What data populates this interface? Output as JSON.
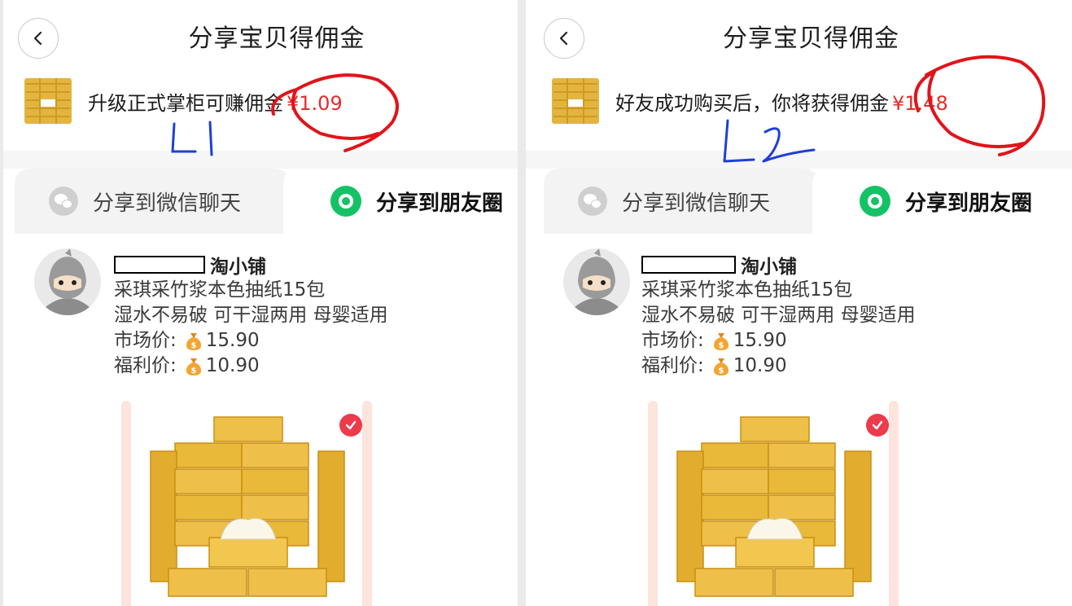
{
  "left_panel": {
    "title": "分享宝贝得佣金",
    "promo_text": "升级正式掌柜可赚佣金",
    "promo_amount": "¥1.09",
    "annotation_label": "L1",
    "tabs": [
      {
        "label": "分享到微信聊天",
        "icon": "wechat-icon",
        "active": false
      },
      {
        "label": "分享到朋友圈",
        "icon": "moments-icon",
        "active": true
      }
    ],
    "shop_name": "淘小铺",
    "product_title": "采琪采竹浆本色抽纸15包",
    "product_subtitle": "湿水不易破 可干湿两用 母婴适用",
    "market_price_label": "市场价:",
    "market_price": "15.90",
    "welfare_price_label": "福利价:",
    "welfare_price": "10.90"
  },
  "right_panel": {
    "title": "分享宝贝得佣金",
    "promo_text": "好友成功购买后，你将获得佣金",
    "promo_amount": "¥1.48",
    "annotation_label": "L2",
    "tabs": [
      {
        "label": "分享到微信聊天",
        "icon": "wechat-icon",
        "active": false
      },
      {
        "label": "分享到朋友圈",
        "icon": "moments-icon",
        "active": true
      }
    ],
    "shop_name": "淘小铺",
    "product_title": "采琪采竹浆本色抽纸15包",
    "product_subtitle": "湿水不易破 可干湿两用 母婴适用",
    "market_price_label": "市场价:",
    "market_price": "15.90",
    "welfare_price_label": "福利价:",
    "welfare_price": "10.90"
  },
  "colors": {
    "accent_red": "#e52b2b",
    "moments_green": "#14c266",
    "annotation_red": "#e0141a",
    "annotation_blue": "#1f3fd6",
    "tissue_yellow": "#e9b93a"
  }
}
